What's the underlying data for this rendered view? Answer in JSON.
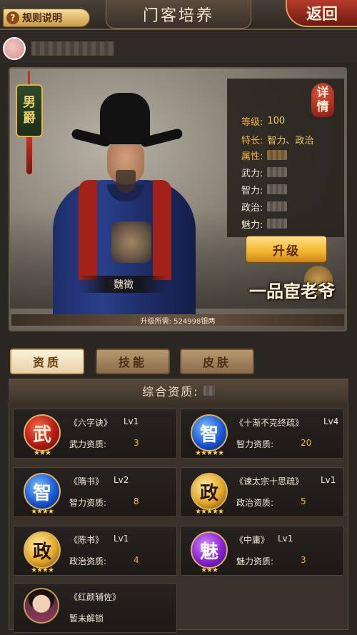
{
  "header": {
    "rules_label": "规则说明",
    "rules_icon": "?",
    "title": "门客培养",
    "back_label": "返回"
  },
  "hero": {
    "rank_label": [
      "男",
      "爵"
    ],
    "name": "魏徵",
    "detail_badge": [
      "详",
      "情"
    ],
    "stats": [
      {
        "label": "等级:",
        "value": "100"
      },
      {
        "label": "特长:",
        "value": "智力、政治"
      },
      {
        "label": "属性:",
        "value": ""
      },
      {
        "label": "武力:",
        "value": ""
      },
      {
        "label": "智力:",
        "value": ""
      },
      {
        "label": "政治:",
        "value": ""
      },
      {
        "label": "魅力:",
        "value": ""
      }
    ],
    "upgrade_label": "升级",
    "title_logo": "一品宦老爷",
    "cost_text": "升级所需: 524998银两"
  },
  "tabs": [
    {
      "label": "资质",
      "active": true
    },
    {
      "label": "技能",
      "active": false
    },
    {
      "label": "皮肤",
      "active": false
    }
  ],
  "aptitude": {
    "header_label": "综合资质:",
    "cards": [
      {
        "name": "《六字诀》",
        "level": "Lv1",
        "attr": "武力资质:",
        "value": "3",
        "badge": "武",
        "color": "red",
        "stars": "★★★"
      },
      {
        "name": "《十渐不克终疏》",
        "level": "Lv4",
        "attr": "智力资质:",
        "value": "20",
        "badge": "智",
        "color": "blue",
        "stars": "★★★★★"
      },
      {
        "name": "《隋书》",
        "level": "Lv2",
        "attr": "智力资质:",
        "value": "8",
        "badge": "智",
        "color": "blue",
        "stars": "★★★★"
      },
      {
        "name": "《谏太宗十思疏》",
        "level": "Lv1",
        "attr": "政治资质:",
        "value": "5",
        "badge": "政",
        "color": "gold",
        "stars": "★★★★★"
      },
      {
        "name": "《陈书》",
        "level": "Lv1",
        "attr": "政治资质:",
        "value": "4",
        "badge": "政",
        "color": "gold",
        "stars": "★★★★"
      },
      {
        "name": "《中庸》",
        "level": "Lv1",
        "attr": "魅力资质:",
        "value": "3",
        "badge": "魅",
        "color": "purple",
        "stars": "★★★"
      }
    ],
    "locked_card": {
      "name": "《红颜辅佐》",
      "status": "暂未解锁"
    }
  }
}
